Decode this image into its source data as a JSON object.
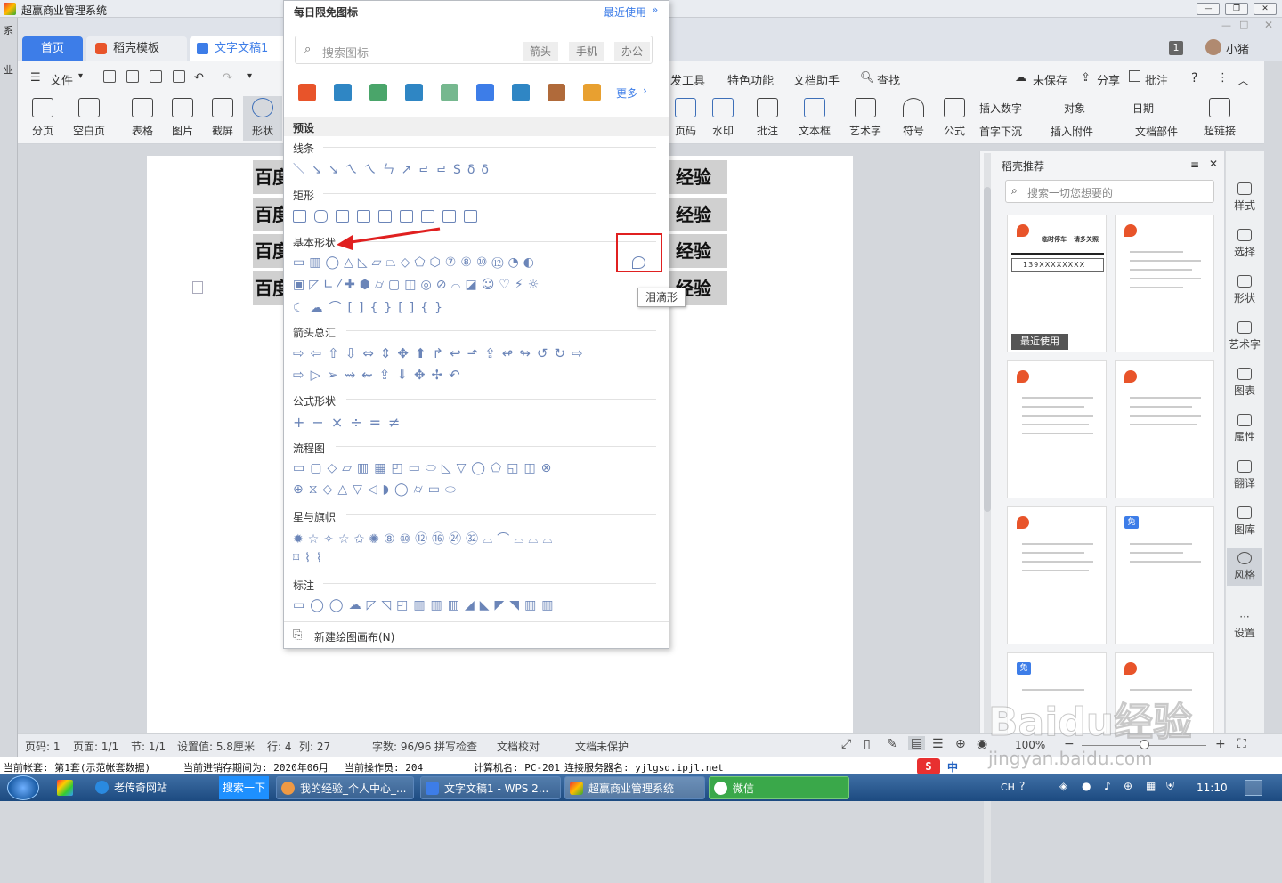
{
  "outer_window": {
    "title": "超赢商业管理系统",
    "min_label": "—",
    "max_label": "❐",
    "close_label": "✕"
  },
  "wps": {
    "left_edge_top": "系",
    "left_edge_bottom": "业",
    "tabs": [
      {
        "label": "首页"
      },
      {
        "label": "稻壳模板"
      },
      {
        "label": "文字文稿1"
      }
    ],
    "window_badge": "1",
    "user_name": "小猪",
    "menu": {
      "file_label": "文件",
      "dev_tools_partial": "发工具",
      "features": "特色功能",
      "doc_assistant": "文档助手",
      "find": "查找",
      "unsaved": "未保存",
      "share": "分享",
      "comment": "批注",
      "help": "?"
    },
    "ribbon_left": [
      {
        "label": "分页",
        "icon": "page-break-icon"
      },
      {
        "label": "空白页",
        "icon": "blank-page-icon"
      },
      {
        "label": "表格",
        "icon": "table-icon"
      },
      {
        "label": "图片",
        "icon": "picture-icon"
      },
      {
        "label": "截屏",
        "icon": "screenshot-icon"
      },
      {
        "label": "形状",
        "icon": "shape-icon"
      }
    ],
    "ribbon_right": [
      {
        "label": "页码",
        "icon": "page-number-icon"
      },
      {
        "label": "水印",
        "icon": "watermark-icon"
      },
      {
        "label": "批注",
        "icon": "comment-icon"
      },
      {
        "label": "文本框",
        "icon": "textbox-icon"
      },
      {
        "label": "艺术字",
        "icon": "wordart-icon"
      },
      {
        "label": "符号",
        "icon": "omega-icon"
      },
      {
        "label": "公式",
        "icon": "pi-icon"
      }
    ],
    "ribbon_small": [
      {
        "label": "插入数字"
      },
      {
        "label": "对象"
      },
      {
        "label": "日期"
      },
      {
        "label": "首字下沉"
      },
      {
        "label": "插入附件"
      },
      {
        "label": "文档部件"
      }
    ],
    "hyperlink_label": "超链接"
  },
  "dropdown": {
    "title": "每日限免图标",
    "recent_link": "最近使用",
    "search_placeholder": "搜索图标",
    "search_chips": [
      "箭头",
      "手机",
      "办公"
    ],
    "more": "更多",
    "preset": "预设",
    "sections": {
      "lines": "线条",
      "rect": "矩形",
      "basic": "基本形状",
      "arrows": "箭头总汇",
      "formula": "公式形状",
      "flow": "流程图",
      "stars": "星与旗帜",
      "callouts": "标注"
    },
    "tooltip": "泪滴形",
    "new_canvas": "新建绘图画布(N)",
    "accent": "#e02020"
  },
  "document": {
    "lines": [
      {
        "left": "百度",
        "right": "经验"
      },
      {
        "left": "百度",
        "right": "经验"
      },
      {
        "left": "百度",
        "right": "经验"
      },
      {
        "left": "百度",
        "right": "经验"
      }
    ]
  },
  "right_panel": {
    "title": "稻壳推荐",
    "search_placeholder": "搜索一切您想要的",
    "recent_badge": "最近使用",
    "phone_number": "139XXXXXXXX",
    "card1_tags": [
      "临时停车",
      "请多关照"
    ],
    "free_badge": "免"
  },
  "sidebar": [
    {
      "label": "样式",
      "icon": "style-icon"
    },
    {
      "label": "选择",
      "icon": "cursor-icon"
    },
    {
      "label": "形状",
      "icon": "shape-icon"
    },
    {
      "label": "艺术字",
      "icon": "wordart-icon"
    },
    {
      "label": "图表",
      "icon": "chart-icon"
    },
    {
      "label": "属性",
      "icon": "properties-icon"
    },
    {
      "label": "翻译",
      "icon": "translate-icon"
    },
    {
      "label": "图库",
      "icon": "gallery-icon"
    },
    {
      "label": "风格",
      "icon": "style-shield-icon"
    },
    {
      "label": "设置",
      "icon": "more-icon"
    }
  ],
  "status": {
    "page": "页码: 1",
    "pages": "页面: 1/1",
    "section": "节: 1/1",
    "setting": "设置值: 5.8厘米",
    "row": "行: 4",
    "col": "列: 27",
    "words": "字数: 96/96",
    "spell": "拼写检查",
    "proof": "文档校对",
    "protect": "文档未保护",
    "zoom": "100%"
  },
  "sysbar": {
    "account": "当前帐套: 第1套(示范帐套数据)",
    "period": "当前进销存期间为: 2020年06月",
    "operator": "当前操作员: 204",
    "computer": "计算机名: PC-201",
    "server": "连接服务器名: yjlgsd.ipjl.net"
  },
  "taskbar": {
    "items": [
      "老传奇网站",
      "搜索一下",
      "我的经验_个人中心_...",
      "文字文稿1 - WPS 2...",
      "超赢商业管理系统",
      "微信"
    ],
    "ime": "CH",
    "clock": "11:10",
    "ime_zh": "中"
  },
  "watermark": "Baidu经验",
  "watermark_url": "jingyan.baidu.com"
}
